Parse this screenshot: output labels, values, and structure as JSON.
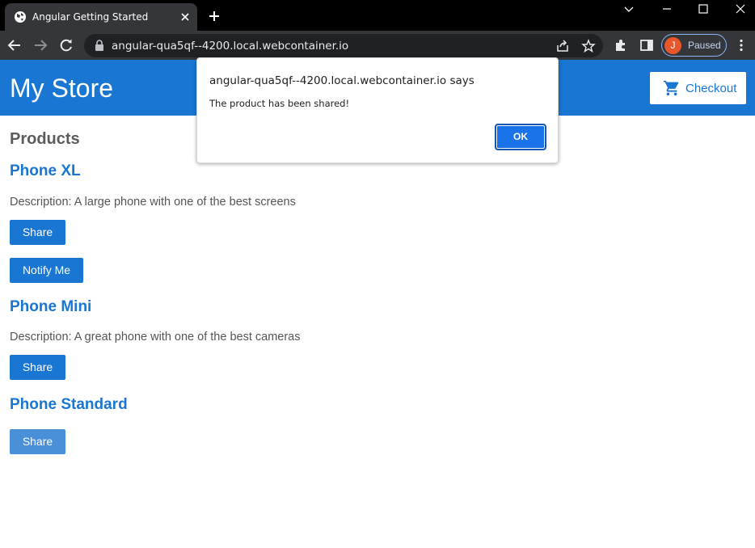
{
  "browser": {
    "tab_title": "Angular Getting Started",
    "url": "angular-qua5qf--4200.local.webcontainer.io",
    "profile_initial": "J",
    "profile_status": "Paused"
  },
  "page": {
    "store_title": "My Store",
    "checkout_label": "Checkout",
    "products_heading": "Products",
    "products": [
      {
        "name": "Phone XL",
        "description": "Description: A large phone with one of the best screens",
        "share_label": "Share",
        "notify_label": "Notify Me"
      },
      {
        "name": "Phone Mini",
        "description": "Description: A great phone with one of the best cameras",
        "share_label": "Share"
      },
      {
        "name": "Phone Standard",
        "share_label": "Share"
      }
    ]
  },
  "dialog": {
    "origin": "angular-qua5qf--4200.local.webcontainer.io says",
    "message": "The product has been shared!",
    "ok_label": "OK"
  },
  "colors": {
    "primary": "#1976d2",
    "dialog_button": "#1a73e8",
    "profile_avatar": "#e8572b"
  }
}
